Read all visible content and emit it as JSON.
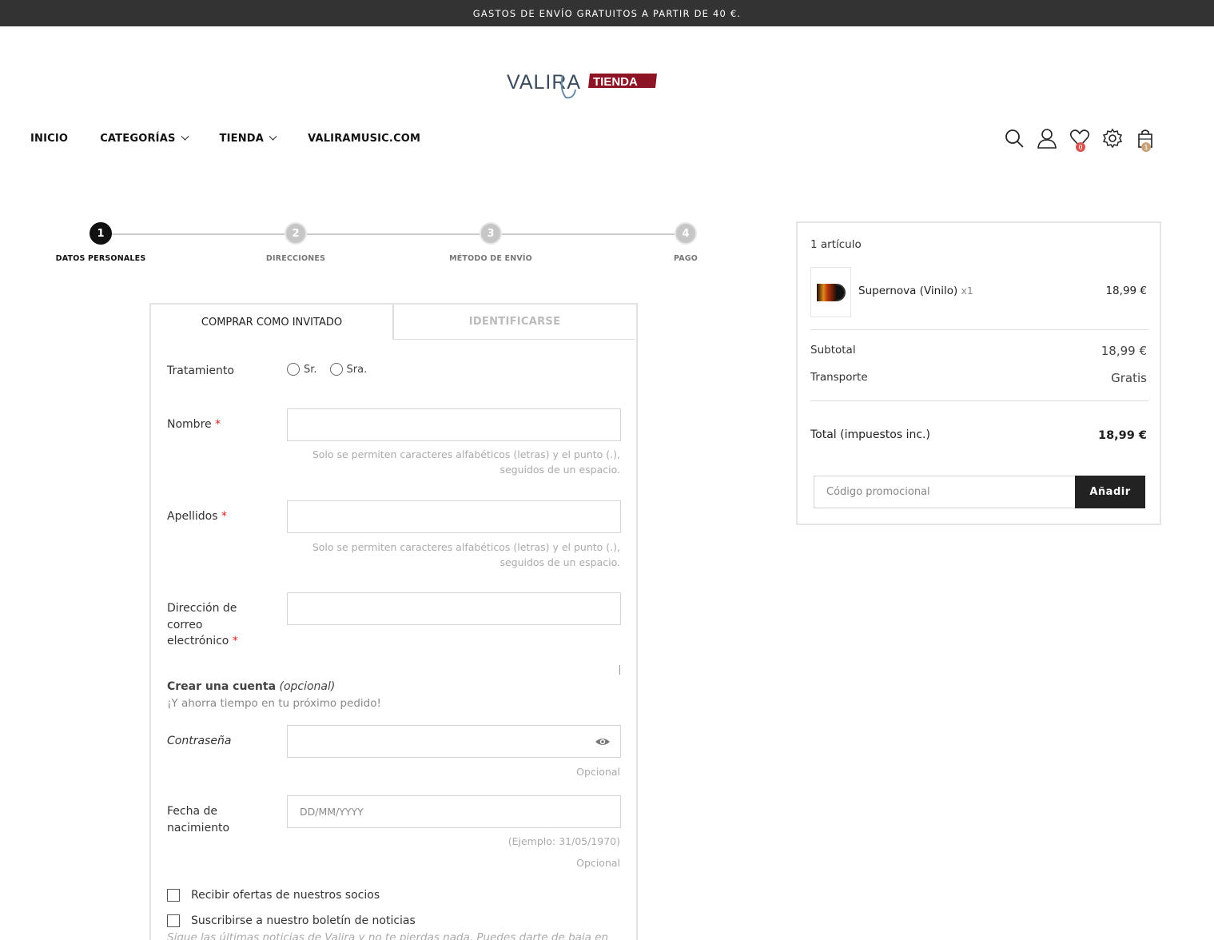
{
  "topbar": {
    "text": "GASTOS DE ENVÍO GRATUITOS A PARTIR DE 40 €."
  },
  "logo": {
    "text_left": "VALIRA",
    "text_right": "TIENDA"
  },
  "nav": {
    "items": [
      {
        "label": "INICIO",
        "has_dropdown": false
      },
      {
        "label": "CATEGORÍAS",
        "has_dropdown": true
      },
      {
        "label": "TIENDA",
        "has_dropdown": true
      },
      {
        "label": "VALIRAMUSIC.COM",
        "has_dropdown": false
      }
    ]
  },
  "header_icons": {
    "wishlist_count": "0",
    "cart_count": "1",
    "badge_wishlist_color": "#d9534f",
    "badge_cart_color": "#c8a27a"
  },
  "stepper": {
    "steps": [
      {
        "number": "1",
        "label": "DATOS PERSONALES",
        "active": true
      },
      {
        "number": "2",
        "label": "DIRECCIONES",
        "active": false
      },
      {
        "number": "3",
        "label": "MÉTODO DE ENVÍO",
        "active": false
      },
      {
        "number": "4",
        "label": "PAGO",
        "active": false
      }
    ]
  },
  "form": {
    "tabs": {
      "guest": "COMPRAR COMO INVITADO",
      "login": "IDENTIFICARSE"
    },
    "title_label": "Tratamiento",
    "title_options": [
      "Sr.",
      "Sra."
    ],
    "first_name_label": "Nombre",
    "first_name_hint_1": "Solo se permiten caracteres alfabéticos (letras) y el punto (.),",
    "first_name_hint_2": "seguidos de un espacio.",
    "last_name_label": "Apellidos",
    "last_name_hint_1": "Solo se permiten caracteres alfabéticos (letras) y el punto (.),",
    "last_name_hint_2": "seguidos de un espacio.",
    "email_label_1": "Dirección de",
    "email_label_2": "correo",
    "email_label_3": "electrónico",
    "required_mark": "*",
    "create_account_title": "Crear una cuenta",
    "create_account_optional": "(opcional)",
    "create_account_sub": "¡Y ahorra tiempo en tu próximo pedido!",
    "password_label": "Contraseña",
    "password_hint": "Opcional",
    "birthday_label_1": "Fecha de",
    "birthday_label_2": "nacimiento",
    "birthday_placeholder": "DD/MM/YYYY",
    "birthday_example": "(Ejemplo: 31/05/1970)",
    "birthday_hint": "Opcional",
    "optin_label": "Recibir ofertas de nuestros socios",
    "newsletter_label": "Suscribirse a nuestro boletín de noticias",
    "newsletter_note": "Sigue las últimas noticias de Valira y no te pierdas nada. Puedes darte de baja en"
  },
  "summary": {
    "count": "1 artículo",
    "product_name": "Supernova (Vinilo)",
    "product_qty": "x1",
    "product_price": "18,99 €",
    "subtotal_label": "Subtotal",
    "subtotal_value": "18,99 €",
    "shipping_label": "Transporte",
    "shipping_value": "Gratis",
    "total_label": "Total (impuestos inc.)",
    "total_value": "18,99 €",
    "promo_placeholder": "Código promocional",
    "promo_button": "Añadir"
  }
}
